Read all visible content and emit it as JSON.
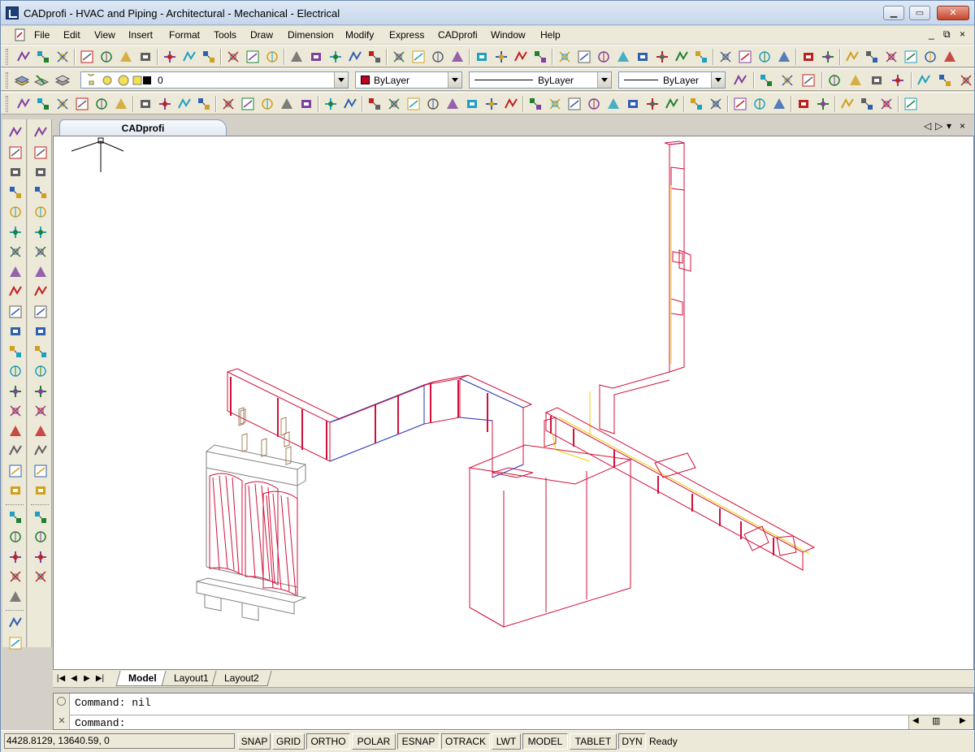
{
  "window": {
    "title": "CADprofi - HVAC and Piping - Architectural - Mechanical - Electrical",
    "controls": [
      "minimize",
      "maximize",
      "close"
    ]
  },
  "menu": {
    "items": [
      "File",
      "Edit",
      "View",
      "Insert",
      "Format",
      "Tools",
      "Draw",
      "Dimension",
      "Modify",
      "Express",
      "CADprofi",
      "Window",
      "Help"
    ],
    "mdi_controls": [
      "_",
      "⧉",
      "×"
    ]
  },
  "properties": {
    "layer_value": "0",
    "color_value": "ByLayer",
    "linetype_value": "ByLayer",
    "lineweight_value": "ByLayer",
    "color_swatch": "#c00020"
  },
  "drawing": {
    "file_tab": "CADprofi",
    "tab_controls": [
      "◁",
      "▷",
      "▾",
      "×"
    ]
  },
  "layouts": {
    "tabs": [
      "Model",
      "Layout1",
      "Layout2"
    ],
    "active": "Model"
  },
  "command": {
    "history": "Command: nil",
    "prompt": "Command:"
  },
  "status": {
    "coordinates": "4428.8129, 13640.59, 0",
    "buttons": [
      "SNAP",
      "GRID",
      "ORTHO",
      "POLAR",
      "ESNAP",
      "OTRACK",
      "LWT",
      "MODEL",
      "TABLET",
      "DYN"
    ],
    "message": "Ready"
  },
  "colors": {
    "duct": "#d0103a",
    "pipe_yellow": "#e8d000",
    "blue_edge": "#2030b0",
    "crosshair": "#000000"
  }
}
